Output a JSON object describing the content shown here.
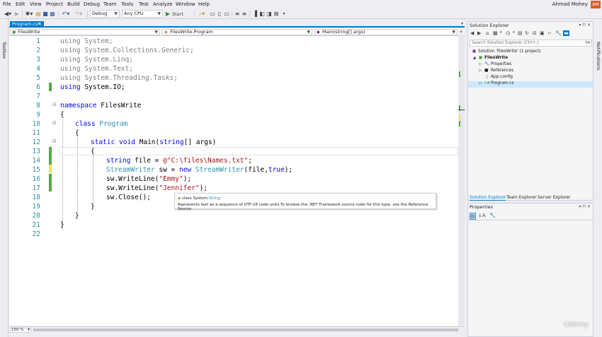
{
  "menu": [
    "File",
    "Edit",
    "View",
    "Project",
    "Build",
    "Debug",
    "Team",
    "Tools",
    "Test",
    "Analyze",
    "Window",
    "Help"
  ],
  "user": {
    "name": "Ahmad Mohey",
    "initials": "AM"
  },
  "toolbar": {
    "configuration": "Debug",
    "platform": "Any CPU",
    "start_label": "Start"
  },
  "toolbox_label": "Toolbox",
  "notifications_label": "Notifications",
  "document_tab": {
    "label": "Program.cs*"
  },
  "navbar": {
    "project": "FilesWrite",
    "class": "FilesWrite.Program",
    "member": "Main(string[] args)"
  },
  "editor": {
    "line_numbers": [
      "1",
      "2",
      "3",
      "4",
      "5",
      "6",
      "7",
      "8",
      "9",
      "10",
      "11",
      "12",
      "13",
      "14",
      "15",
      "16",
      "17",
      "18",
      "19",
      "20",
      "21",
      "22"
    ],
    "lines": {
      "l1": "using System;",
      "l2": "using System.Collections.Generic;",
      "l3": "using System.Linq;",
      "l4": "using System.Text;",
      "l5": "using System.Threading.Tasks;",
      "l6_kw": "using",
      "l6_rest": " System.IO;",
      "l8_kw": "namespace",
      "l8_rest": " FilesWrite",
      "l9": "{",
      "l10_kw": "class",
      "l10_ty": "Program",
      "l11": "{",
      "l12_kw": "static void",
      "l12_mid": " Main(",
      "l12_ty": "string",
      "l12_rest": "[] args)",
      "l13": "{",
      "l14_kw": "string",
      "l14_mid": " file = ",
      "l14_str": "@\"C:\\files\\Names.txt\"",
      "l14_end": ";",
      "l15_ty": "StreamWriter",
      "l15_mid": " sw = ",
      "l15_kw": "new",
      "l15_ty2": "StreamWriter",
      "l15_mid2": "(file,",
      "l15_kw2": "true",
      "l15_end": ");",
      "l16_pre": "sw.WriteLine(",
      "l16_str": "\"Emmy\"",
      "l16_end": ");",
      "l17_pre": "sw.WriteLine(",
      "l17_str": "\"Jennifer\"",
      "l17_end": ");",
      "l18": "sw.Close();",
      "l19": "}",
      "l20": "}",
      "l21": "}"
    },
    "zoom": "150 %"
  },
  "tooltip": {
    "kind": "class",
    "namespace": "System.",
    "type": "String",
    "description": "Represents text as a sequence of UTF-16 code units.To browse the .NET Framework source code for this type, see the Reference Source."
  },
  "solution_explorer": {
    "title": "Solution Explorer",
    "search_placeholder": "Search Solution Explorer (Ctrl+;)",
    "items": [
      {
        "label": "Solution 'FilesWrite' (1 project)",
        "icon": "solution-icon"
      },
      {
        "label": "FilesWrite",
        "icon": "csharp-project-icon"
      },
      {
        "label": "Properties",
        "icon": "wrench-icon"
      },
      {
        "label": "References",
        "icon": "references-icon"
      },
      {
        "label": "App.config",
        "icon": "config-file-icon"
      },
      {
        "label": "Program.cs",
        "icon": "csharp-file-icon"
      }
    ],
    "tabs": [
      "Solution Explorer",
      "Team Explorer",
      "Server Explorer"
    ]
  },
  "properties": {
    "title": "Properties"
  },
  "watermark": "Udemy",
  "colors": {
    "accent": "#007acc",
    "keyword": "#0000ff",
    "type": "#2b91af",
    "string": "#a31515",
    "change_saved": "#57a64a",
    "change_unsaved": "#efe256"
  }
}
